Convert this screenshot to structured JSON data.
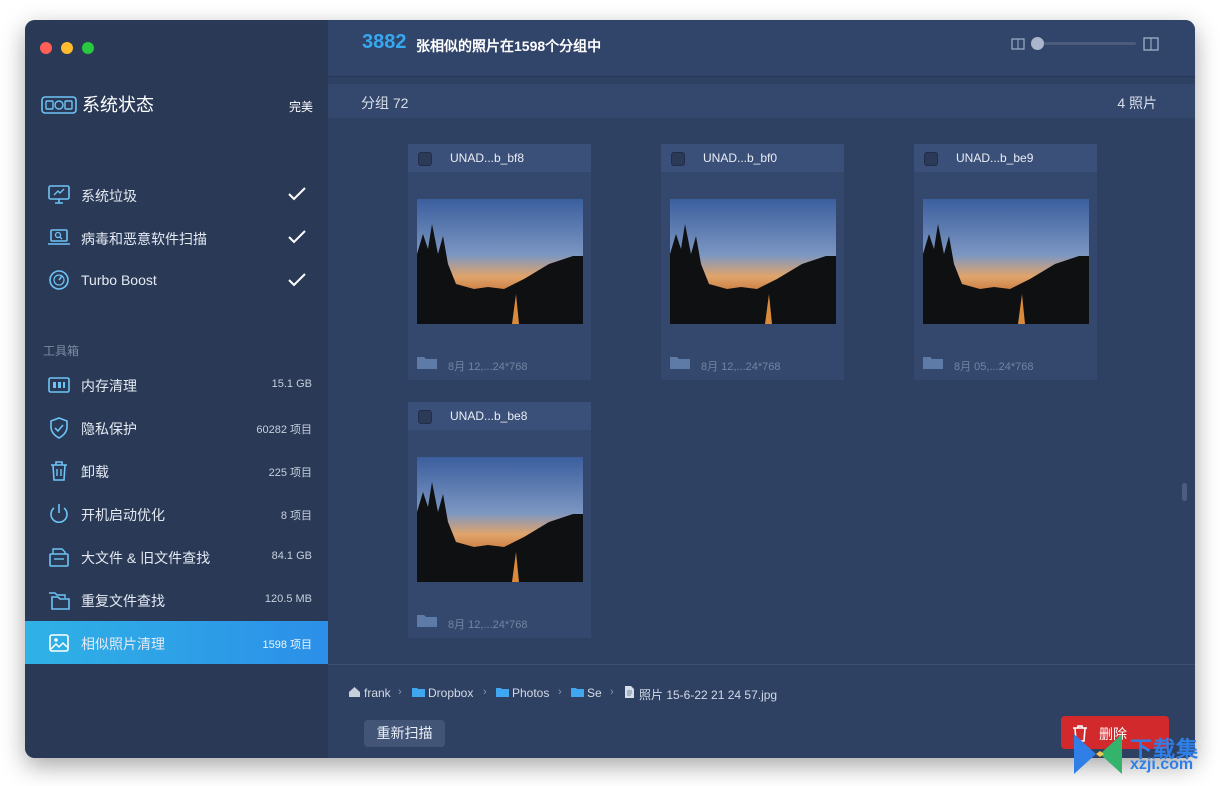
{
  "sidebar": {
    "status": {
      "title": "系统状态",
      "value": "完美"
    },
    "checks": [
      {
        "label": "系统垃圾",
        "icon": "monitor-icon"
      },
      {
        "label": "病毒和恶意软件扫描",
        "icon": "laptop-scan-icon"
      },
      {
        "label": "Turbo Boost",
        "icon": "speedometer-icon"
      }
    ],
    "section_title": "工具箱",
    "tools": [
      {
        "label": "内存清理",
        "meta": "15.1 GB",
        "icon": "memory-icon"
      },
      {
        "label": "隐私保护",
        "meta": "60282 项目",
        "icon": "shield-icon"
      },
      {
        "label": "卸载",
        "meta": "225 项目",
        "icon": "trash-icon"
      },
      {
        "label": "开机启动优化",
        "meta": "8 项目",
        "icon": "power-icon"
      },
      {
        "label": "大文件 & 旧文件查找",
        "meta": "84.1 GB",
        "icon": "file-box-icon"
      },
      {
        "label": "重复文件查找",
        "meta": "120.5 MB",
        "icon": "duplicate-folder-icon"
      },
      {
        "label": "相似照片清理",
        "meta": "1598 项目",
        "icon": "photo-icon",
        "active": true
      }
    ]
  },
  "header": {
    "count": "3882",
    "text": "张相似的照片在1598个分组中"
  },
  "group": {
    "name": "分组 72",
    "count": "4 照片"
  },
  "photos": [
    {
      "name": "UNAD...b_bf8",
      "info": "8月 12,...24*768"
    },
    {
      "name": "UNAD...b_bf0",
      "info": "8月 12,...24*768"
    },
    {
      "name": "UNAD...b_be9",
      "info": "8月 05,...24*768"
    },
    {
      "name": "UNAD...b_be8",
      "info": "8月 12,...24*768"
    }
  ],
  "path": [
    {
      "label": "frank",
      "icon": "home-icon"
    },
    {
      "label": "Dropbox",
      "icon": "folder-icon"
    },
    {
      "label": "Photos",
      "icon": "folder-icon"
    },
    {
      "label": "Se",
      "icon": "folder-icon"
    },
    {
      "label": "照片 15-6-22 21 24 57.jpg",
      "icon": "document-icon"
    }
  ],
  "buttons": {
    "rescan": "重新扫描",
    "delete": "删除"
  },
  "watermark": {
    "title": "下载集",
    "url": "xzji.com"
  },
  "colors": {
    "accent": "#36a8f0",
    "sidebar_active": "#2fb2e6",
    "danger": "#d2292c",
    "background": "#2f4163"
  }
}
